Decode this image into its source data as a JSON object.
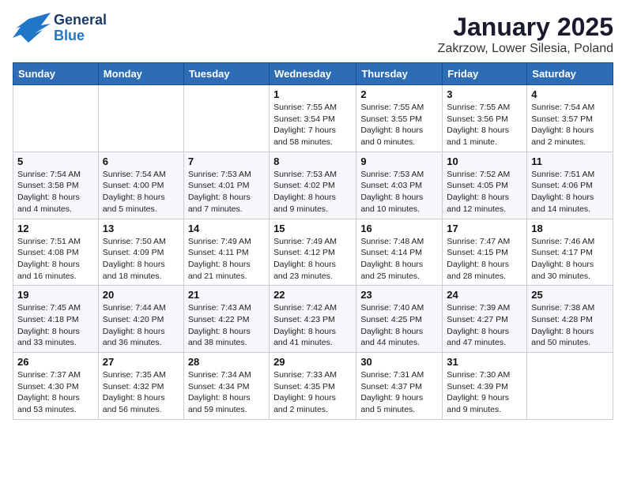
{
  "header": {
    "logo_general": "General",
    "logo_blue": "Blue",
    "title": "January 2025",
    "subtitle": "Zakrzow, Lower Silesia, Poland"
  },
  "days_of_week": [
    "Sunday",
    "Monday",
    "Tuesday",
    "Wednesday",
    "Thursday",
    "Friday",
    "Saturday"
  ],
  "weeks": [
    {
      "days": [
        {
          "num": "",
          "detail": ""
        },
        {
          "num": "",
          "detail": ""
        },
        {
          "num": "",
          "detail": ""
        },
        {
          "num": "1",
          "detail": "Sunrise: 7:55 AM\nSunset: 3:54 PM\nDaylight: 7 hours\nand 58 minutes."
        },
        {
          "num": "2",
          "detail": "Sunrise: 7:55 AM\nSunset: 3:55 PM\nDaylight: 8 hours\nand 0 minutes."
        },
        {
          "num": "3",
          "detail": "Sunrise: 7:55 AM\nSunset: 3:56 PM\nDaylight: 8 hours\nand 1 minute."
        },
        {
          "num": "4",
          "detail": "Sunrise: 7:54 AM\nSunset: 3:57 PM\nDaylight: 8 hours\nand 2 minutes."
        }
      ]
    },
    {
      "days": [
        {
          "num": "5",
          "detail": "Sunrise: 7:54 AM\nSunset: 3:58 PM\nDaylight: 8 hours\nand 4 minutes."
        },
        {
          "num": "6",
          "detail": "Sunrise: 7:54 AM\nSunset: 4:00 PM\nDaylight: 8 hours\nand 5 minutes."
        },
        {
          "num": "7",
          "detail": "Sunrise: 7:53 AM\nSunset: 4:01 PM\nDaylight: 8 hours\nand 7 minutes."
        },
        {
          "num": "8",
          "detail": "Sunrise: 7:53 AM\nSunset: 4:02 PM\nDaylight: 8 hours\nand 9 minutes."
        },
        {
          "num": "9",
          "detail": "Sunrise: 7:53 AM\nSunset: 4:03 PM\nDaylight: 8 hours\nand 10 minutes."
        },
        {
          "num": "10",
          "detail": "Sunrise: 7:52 AM\nSunset: 4:05 PM\nDaylight: 8 hours\nand 12 minutes."
        },
        {
          "num": "11",
          "detail": "Sunrise: 7:51 AM\nSunset: 4:06 PM\nDaylight: 8 hours\nand 14 minutes."
        }
      ]
    },
    {
      "days": [
        {
          "num": "12",
          "detail": "Sunrise: 7:51 AM\nSunset: 4:08 PM\nDaylight: 8 hours\nand 16 minutes."
        },
        {
          "num": "13",
          "detail": "Sunrise: 7:50 AM\nSunset: 4:09 PM\nDaylight: 8 hours\nand 18 minutes."
        },
        {
          "num": "14",
          "detail": "Sunrise: 7:49 AM\nSunset: 4:11 PM\nDaylight: 8 hours\nand 21 minutes."
        },
        {
          "num": "15",
          "detail": "Sunrise: 7:49 AM\nSunset: 4:12 PM\nDaylight: 8 hours\nand 23 minutes."
        },
        {
          "num": "16",
          "detail": "Sunrise: 7:48 AM\nSunset: 4:14 PM\nDaylight: 8 hours\nand 25 minutes."
        },
        {
          "num": "17",
          "detail": "Sunrise: 7:47 AM\nSunset: 4:15 PM\nDaylight: 8 hours\nand 28 minutes."
        },
        {
          "num": "18",
          "detail": "Sunrise: 7:46 AM\nSunset: 4:17 PM\nDaylight: 8 hours\nand 30 minutes."
        }
      ]
    },
    {
      "days": [
        {
          "num": "19",
          "detail": "Sunrise: 7:45 AM\nSunset: 4:18 PM\nDaylight: 8 hours\nand 33 minutes."
        },
        {
          "num": "20",
          "detail": "Sunrise: 7:44 AM\nSunset: 4:20 PM\nDaylight: 8 hours\nand 36 minutes."
        },
        {
          "num": "21",
          "detail": "Sunrise: 7:43 AM\nSunset: 4:22 PM\nDaylight: 8 hours\nand 38 minutes."
        },
        {
          "num": "22",
          "detail": "Sunrise: 7:42 AM\nSunset: 4:23 PM\nDaylight: 8 hours\nand 41 minutes."
        },
        {
          "num": "23",
          "detail": "Sunrise: 7:40 AM\nSunset: 4:25 PM\nDaylight: 8 hours\nand 44 minutes."
        },
        {
          "num": "24",
          "detail": "Sunrise: 7:39 AM\nSunset: 4:27 PM\nDaylight: 8 hours\nand 47 minutes."
        },
        {
          "num": "25",
          "detail": "Sunrise: 7:38 AM\nSunset: 4:28 PM\nDaylight: 8 hours\nand 50 minutes."
        }
      ]
    },
    {
      "days": [
        {
          "num": "26",
          "detail": "Sunrise: 7:37 AM\nSunset: 4:30 PM\nDaylight: 8 hours\nand 53 minutes."
        },
        {
          "num": "27",
          "detail": "Sunrise: 7:35 AM\nSunset: 4:32 PM\nDaylight: 8 hours\nand 56 minutes."
        },
        {
          "num": "28",
          "detail": "Sunrise: 7:34 AM\nSunset: 4:34 PM\nDaylight: 8 hours\nand 59 minutes."
        },
        {
          "num": "29",
          "detail": "Sunrise: 7:33 AM\nSunset: 4:35 PM\nDaylight: 9 hours\nand 2 minutes."
        },
        {
          "num": "30",
          "detail": "Sunrise: 7:31 AM\nSunset: 4:37 PM\nDaylight: 9 hours\nand 5 minutes."
        },
        {
          "num": "31",
          "detail": "Sunrise: 7:30 AM\nSunset: 4:39 PM\nDaylight: 9 hours\nand 9 minutes."
        },
        {
          "num": "",
          "detail": ""
        }
      ]
    }
  ]
}
